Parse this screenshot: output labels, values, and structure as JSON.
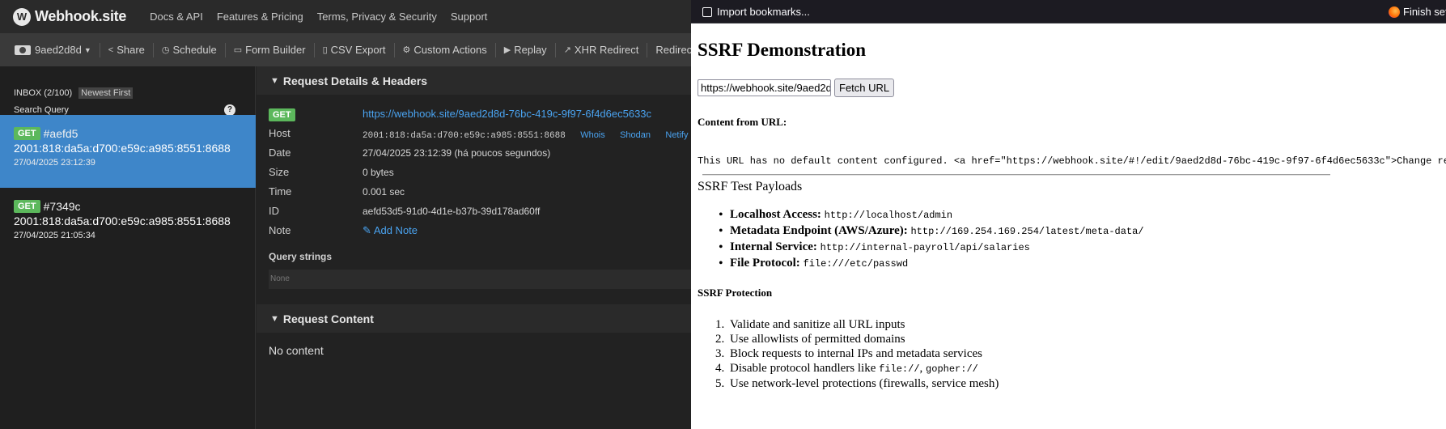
{
  "webhook": {
    "brand": "Webhook.site",
    "nav": [
      "Docs & API",
      "Features & Pricing",
      "Terms, Privacy & Security",
      "Support"
    ],
    "toolbar": {
      "token": "9aed2d8d",
      "items": [
        "Share",
        "Schedule",
        "Form Builder",
        "CSV Export",
        "Custom Actions",
        "Replay",
        "XHR Redirect",
        "Redirect"
      ]
    },
    "inbox": {
      "title": "INBOX (2/100)",
      "sort": "Newest First",
      "search_placeholder": "Search Query",
      "requests": [
        {
          "method": "GET",
          "id": "#aefd5",
          "ip": "2001:818:da5a:d700:e59c:a985:8551:8688",
          "time": "27/04/2025 23:12:39"
        },
        {
          "method": "GET",
          "id": "#7349c",
          "ip": "2001:818:da5a:d700:e59c:a985:8551:8688",
          "time": "27/04/2025 21:05:34"
        }
      ]
    },
    "details": {
      "heading": "Request Details & Headers",
      "method": "GET",
      "url": "https://webhook.site/9aed2d8d-76bc-419c-9f97-6f4d6ec5633c",
      "host_label": "Host",
      "host": "2001:818:da5a:d700:e59c:a985:8551:8688",
      "host_links": [
        "Whois",
        "Shodan",
        "Netify",
        "Ce"
      ],
      "date_label": "Date",
      "date": "27/04/2025 23:12:39 (há poucos segundos)",
      "size_label": "Size",
      "size": "0 bytes",
      "time_label": "Time",
      "time": "0.001 sec",
      "id_label": "ID",
      "id": "aefd53d5-91d0-4d1e-b37b-39d178ad60ff",
      "note_label": "Note",
      "add_note": "Add Note",
      "query_title": "Query strings",
      "query_none": "None",
      "content_heading": "Request Content",
      "no_content": "No content"
    }
  },
  "browser": {
    "import_bookmarks": "Import bookmarks...",
    "finish_setup": "Finish set"
  },
  "ssrf": {
    "title": "SSRF Demonstration",
    "input_value": "https://webhook.site/9aed2d8d-76bc-419c-9f97-6f4d6ec5633c",
    "fetch_button": "Fetch URL",
    "content_heading": "Content from URL:",
    "content_text": "This URL has no default content configured. <a href=\"https://webhook.site/#!/edit/9aed2d8d-76bc-419c-9f97-6f4d6ec5633c\">Change res",
    "payloads_title": "SSRF Test Payloads",
    "payloads": [
      {
        "label": "Localhost Access:",
        "value": "http://localhost/admin"
      },
      {
        "label": "Metadata Endpoint (AWS/Azure):",
        "value": "http://169.254.169.254/latest/meta-data/"
      },
      {
        "label": "Internal Service:",
        "value": "http://internal-payroll/api/salaries"
      },
      {
        "label": "File Protocol:",
        "value": "file:///etc/passwd"
      }
    ],
    "protection_title": "SSRF Protection",
    "protection": {
      "s1": "Validate and sanitize all URL inputs",
      "s2": "Use allowlists of permitted domains",
      "s3": "Block requests to internal IPs and metadata services",
      "s4_prefix": "Disable protocol handlers like ",
      "s4_code1": "file://",
      "s4_sep": ", ",
      "s4_code2": "gopher://",
      "s5": "Use network-level protections (firewalls, service mesh)"
    }
  }
}
